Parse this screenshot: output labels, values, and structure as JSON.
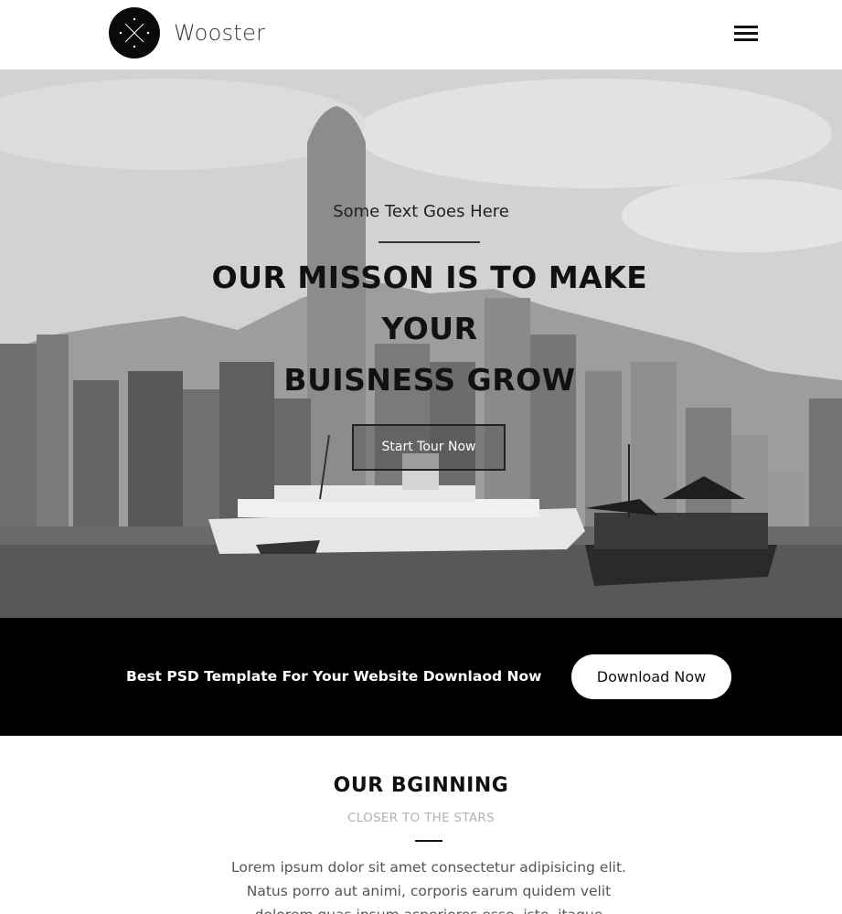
{
  "header": {
    "brand": "Wooster",
    "logo_letters": "X",
    "menu_icon": "hamburger-menu-icon"
  },
  "hero": {
    "subtitle": "Some Text Goes Here",
    "title_lines": [
      "OUR MISSON IS TO MAKE",
      "YOUR",
      "BUISNESS GROW"
    ],
    "button_label": "Start Tour Now"
  },
  "cta_band": {
    "text": "Best PSD Template For Your Website Downlaod Now",
    "button_label": "Download Now"
  },
  "beginning": {
    "title": "OUR BGINNING",
    "subtitle": "CLOSER TO THE STARS",
    "body_lines": [
      "Lorem ipsum dolor sit amet consectetur adipisicing elit.",
      "Natus porro aut animi, corporis earum quidem velit",
      "dolorem quas ipsum asperiores esse, iste, itaque"
    ]
  },
  "colors": {
    "band_background": "#000000",
    "subtitle_gray": "#b3b3b3",
    "text_dark": "#111111"
  }
}
